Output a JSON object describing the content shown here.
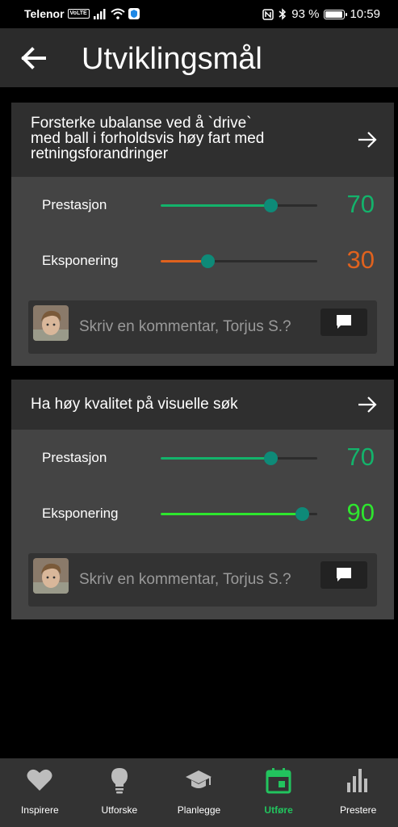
{
  "status_bar": {
    "carrier": "Telenor",
    "network_badge": "VoLTE",
    "battery_text": "93 %",
    "battery_level": 0.93,
    "time": "10:59"
  },
  "header": {
    "title": "Utviklingsmål",
    "back_icon": "arrow-left-icon"
  },
  "goals": [
    {
      "title_lines": [
        "Forsterke ubalanse ved å `drive`",
        "med ball i forholdsvis høy fart med",
        "retningsforandringer"
      ],
      "arrow_icon": "arrow-right-icon",
      "metrics": [
        {
          "label": "Prestasjon",
          "value": 70,
          "display": "70",
          "color": "#13b36b"
        },
        {
          "label": "Eksponering",
          "value": 30,
          "display": "30",
          "color": "#e0621e"
        }
      ],
      "comment": {
        "placeholder": "Skriv en kommentar, Torjus S.?",
        "send_icon": "comment-icon"
      }
    },
    {
      "title_lines": [
        "Ha høy kvalitet på visuelle søk"
      ],
      "arrow_icon": "arrow-right-icon",
      "metrics": [
        {
          "label": "Prestasjon",
          "value": 70,
          "display": "70",
          "color": "#13b36b"
        },
        {
          "label": "Eksponering",
          "value": 90,
          "display": "90",
          "color": "#2ee62e"
        }
      ],
      "comment": {
        "placeholder": "Skriv en kommentar, Torjus S.?",
        "send_icon": "comment-icon"
      }
    }
  ],
  "bottom_nav": {
    "items": [
      {
        "label": "Inspirere",
        "icon": "heart-icon"
      },
      {
        "label": "Utforske",
        "icon": "lightbulb-icon"
      },
      {
        "label": "Planlegge",
        "icon": "graduation-cap-icon"
      },
      {
        "label": "Utføre",
        "icon": "calendar-icon",
        "active": true
      },
      {
        "label": "Prestere",
        "icon": "bar-chart-icon"
      }
    ],
    "active_color": "#22c45e",
    "inactive_color": "#bdbdbd"
  }
}
